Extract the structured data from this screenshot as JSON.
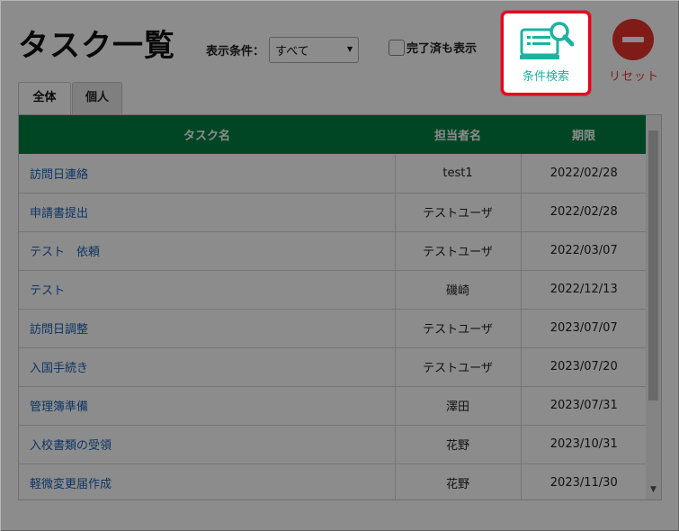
{
  "header": {
    "title": "タスク一覧",
    "filter_label": "表示条件：",
    "filter_value": "すべて",
    "completed_label": "完了済も表示"
  },
  "actions": {
    "search_label": "条件検索",
    "reset_label": "リセット"
  },
  "tabs": [
    {
      "label": "全体"
    },
    {
      "label": "個人"
    }
  ],
  "table": {
    "columns": [
      "タスク名",
      "担当者名",
      "期限"
    ],
    "rows": [
      {
        "name": "訪問日連絡",
        "assignee": "test1",
        "due": "2022/02/28"
      },
      {
        "name": "申請書提出",
        "assignee": "テストユーザ",
        "due": "2022/02/28"
      },
      {
        "name": "テスト　依頼",
        "assignee": "テストユーザ",
        "due": "2022/03/07"
      },
      {
        "name": "テスト",
        "assignee": "磯崎",
        "due": "2022/12/13"
      },
      {
        "name": "訪問日調整",
        "assignee": "テストユーザ",
        "due": "2023/07/07"
      },
      {
        "name": "入国手続き",
        "assignee": "テストユーザ",
        "due": "2023/07/20"
      },
      {
        "name": "管理簿準備",
        "assignee": "澤田",
        "due": "2023/07/31"
      },
      {
        "name": "入校書類の受領",
        "assignee": "花野",
        "due": "2023/10/31"
      },
      {
        "name": "軽微変更届作成",
        "assignee": "花野",
        "due": "2023/11/30"
      }
    ]
  },
  "colors": {
    "header_green": "#008043",
    "accent_teal": "#1bb3a0",
    "reset_red": "#e8332c",
    "highlight_red": "#e8001c",
    "link_blue": "#1a5fb4"
  }
}
